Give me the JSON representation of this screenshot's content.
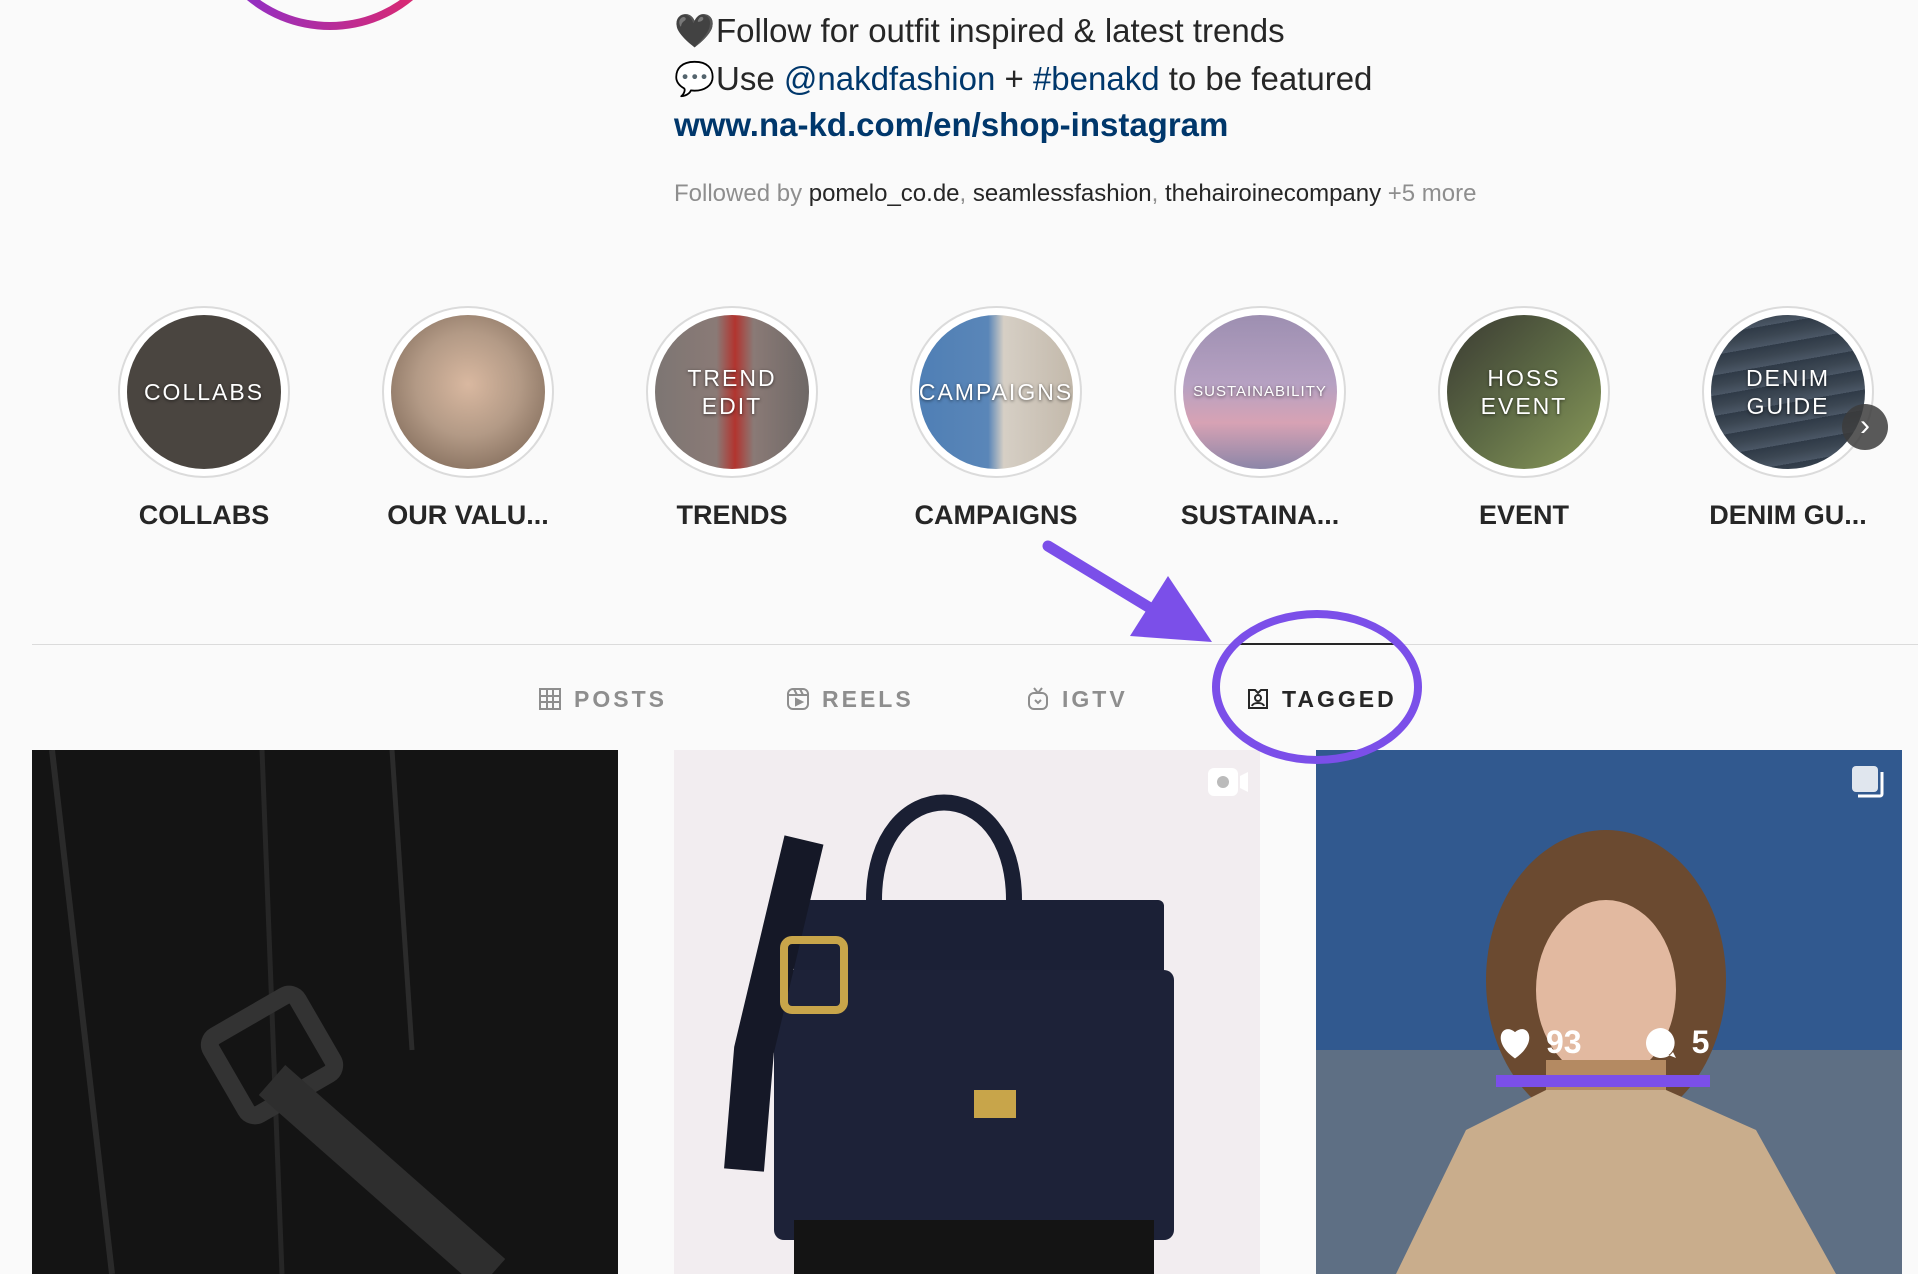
{
  "bio": {
    "line1_emoji": "🖤",
    "line1_text": "Follow for outfit inspired & latest trends",
    "line2_emoji": "💬",
    "line2_prefix": "Use ",
    "line2_handle": "@nakdfashion",
    "line2_plus": " + ",
    "line2_hashtag": "#benakd",
    "line2_suffix": " to be featured",
    "link": "www.na-kd.com/en/shop-instagram"
  },
  "followed_by": {
    "prefix": "Followed by ",
    "user1": "pomelo_co.de",
    "sep1": ", ",
    "user2": "seamlessfashion",
    "sep2": ", ",
    "user3": "thehairoinecompany",
    "more": " +5 more"
  },
  "highlights": [
    {
      "overlay": "COLLABS",
      "label": "COLLABS",
      "color": "#4a4540"
    },
    {
      "overlay": "",
      "label": "OUR VALU...",
      "color": "#b39a86"
    },
    {
      "overlay": "TREND EDIT",
      "label": "TRENDS",
      "color": "#8a7a76"
    },
    {
      "overlay": "CAMPAIGNS",
      "label": "CAMPAIGNS",
      "color": "#a9a39c"
    },
    {
      "overlay": "SUSTAINABILITY",
      "label": "SUSTAINA...",
      "color": "#a695b4"
    },
    {
      "overlay": "HOSS EVENT",
      "label": "EVENT",
      "color": "#5d6a45"
    },
    {
      "overlay": "DENIM GUIDE",
      "label": "DENIM GU...",
      "color": "#3b4652"
    }
  ],
  "tabs": [
    {
      "label": "POSTS",
      "icon": "grid-icon"
    },
    {
      "label": "REELS",
      "icon": "reels-icon"
    },
    {
      "label": "IGTV",
      "icon": "igtv-icon"
    },
    {
      "label": "TAGGED",
      "icon": "tagged-icon",
      "active": true
    }
  ],
  "post_overlay": {
    "likes": "93",
    "comments": "5"
  },
  "colors": {
    "link": "#00376b",
    "annotation": "#7b4fe9",
    "text": "#262626",
    "muted": "#8e8e8e"
  }
}
